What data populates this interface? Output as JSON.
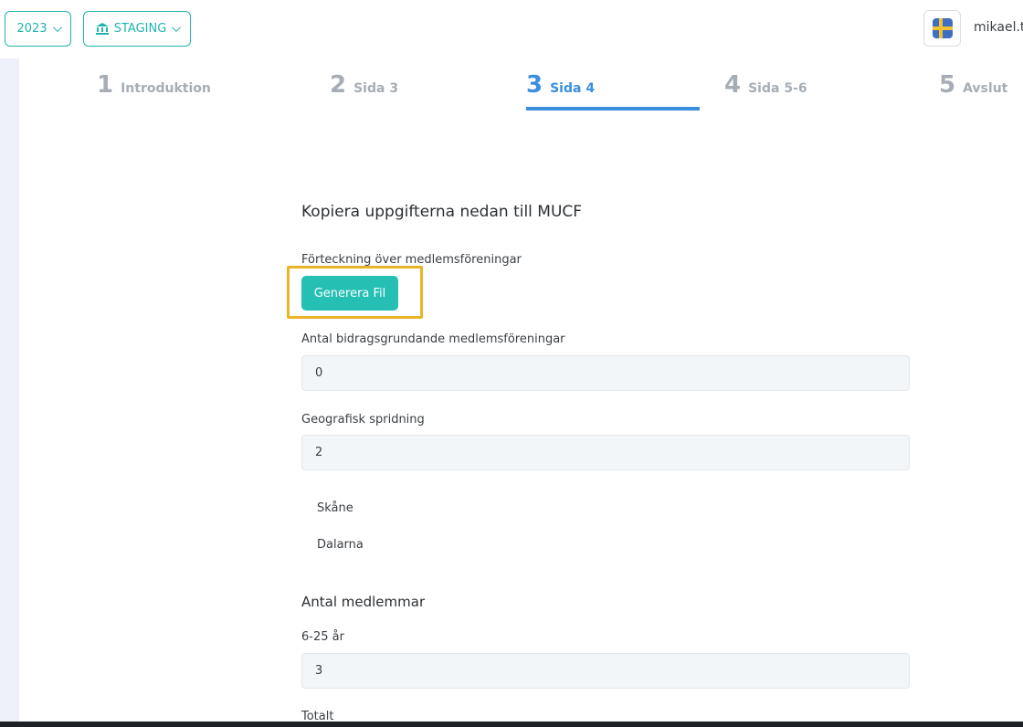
{
  "topbar": {
    "year_label": "2023",
    "env_label": "STAGING",
    "username": "mikael.t"
  },
  "stepper": [
    {
      "num": "1",
      "label": "Introduktion",
      "active": false
    },
    {
      "num": "2",
      "label": "Sida 3",
      "active": false
    },
    {
      "num": "3",
      "label": "Sida 4",
      "active": true
    },
    {
      "num": "4",
      "label": "Sida 5-6",
      "active": false
    },
    {
      "num": "5",
      "label": "Avslut",
      "active": false
    }
  ],
  "form": {
    "title": "Kopiera uppgifterna nedan till MUCF",
    "file_label": "Förteckning över medlemsföreningar",
    "generate_button": "Generera Fil",
    "count_label": "Antal bidragsgrundande medlemsföreningar",
    "count_value": "0",
    "geo_label": "Geografisk spridning",
    "geo_value": "2",
    "regions": [
      "Skåne",
      "Dalarna"
    ],
    "members_heading": "Antal medlemmar",
    "age_label": "6-25 år",
    "age_value": "3",
    "total_label": "Totalt"
  },
  "colors": {
    "accent": "#22b3ad",
    "button": "#25bfb4",
    "active_step": "#3a8fde",
    "highlight": "#e9b526"
  },
  "icons": {
    "year_chevron": "chevron-down-icon",
    "env_icon": "bank-icon",
    "language": "sweden-flag-icon"
  }
}
